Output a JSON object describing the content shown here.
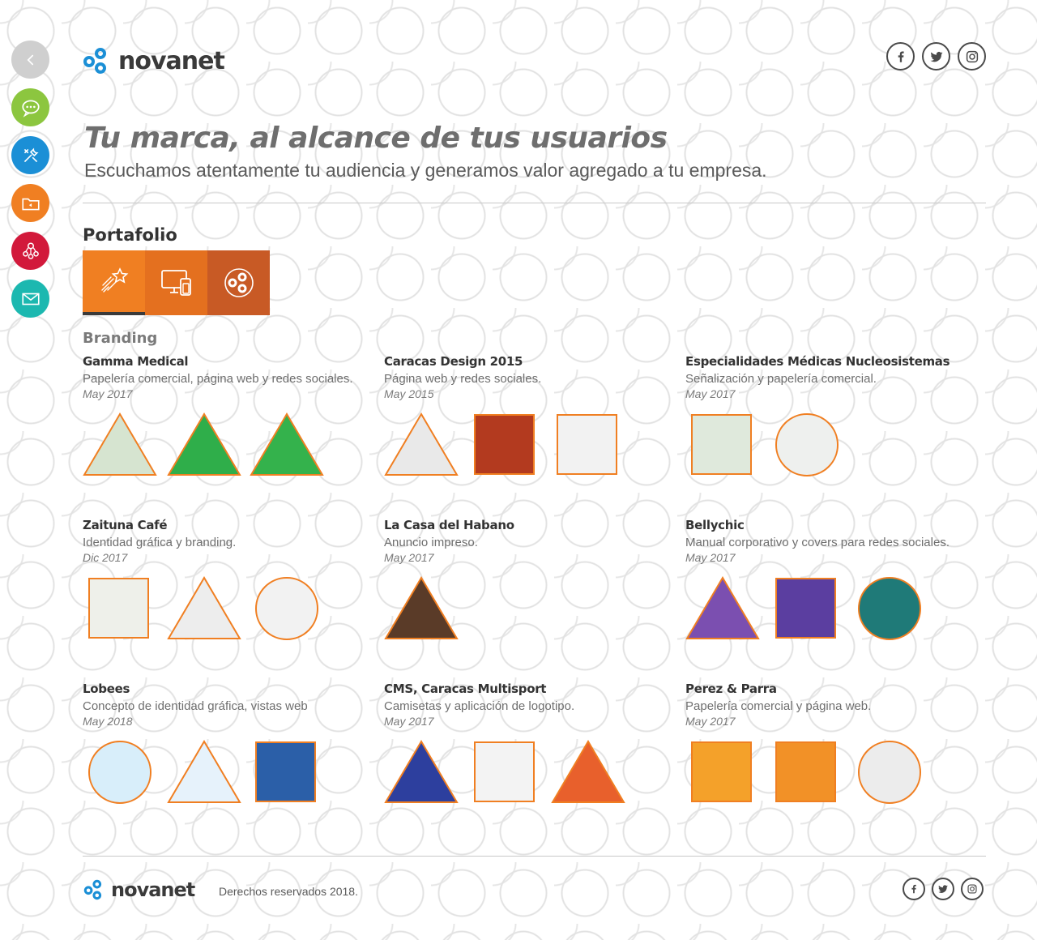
{
  "brand": {
    "name": "novanet"
  },
  "colors": {
    "orange": "#f07f22",
    "tab_mid": "#e4701f",
    "tab_dark": "#c85a25",
    "side_gray": "#cfcfcf",
    "side_green": "#8cc63f",
    "side_blue": "#1b8fd6",
    "side_orange": "#f07f22",
    "side_red": "#d2193b",
    "side_teal": "#1cb8b0",
    "logo_blue": "#1b8fd6"
  },
  "side_nav": [
    {
      "name": "back",
      "icon": "chevron-left-icon"
    },
    {
      "name": "chat",
      "icon": "chat-bubble-icon"
    },
    {
      "name": "tools",
      "icon": "tools-icon"
    },
    {
      "name": "portfolio",
      "icon": "folder-icon"
    },
    {
      "name": "team",
      "icon": "team-icon"
    },
    {
      "name": "contact",
      "icon": "mail-icon"
    }
  ],
  "social": [
    "facebook-icon",
    "twitter-icon",
    "instagram-icon"
  ],
  "hero": {
    "title": "Tu marca, al alcance de tus usuarios",
    "subtitle": "Escuchamos atentamente tu audiencia y generamos valor agregado a tu empresa."
  },
  "portfolio": {
    "title": "Portafolio",
    "tabs": [
      {
        "icon": "shooting-star-icon"
      },
      {
        "icon": "devices-icon"
      },
      {
        "icon": "novanet-circles-icon"
      }
    ],
    "category": "Branding",
    "projects": [
      {
        "title": "Gamma Medical",
        "desc": "Papelería comercial, página web y redes sociales.",
        "date": "May 2017"
      },
      {
        "title": "Caracas Design 2015",
        "desc": "Página web y redes sociales.",
        "date": "May 2015"
      },
      {
        "title": "Especialidades Médicas Nucleosistemas",
        "desc": "Señalización y papelería comercial.",
        "date": "May 2017"
      },
      {
        "title": "Zaituna Café",
        "desc": "Identidad gráfica y branding.",
        "date": "Dic 2017"
      },
      {
        "title": "La Casa del Habano",
        "desc": "Anuncio impreso.",
        "date": "May 2017"
      },
      {
        "title": "Bellychic",
        "desc": "Manual corporativo y covers para redes sociales.",
        "date": "May 2017"
      },
      {
        "title": "Lobees",
        "desc": "Concepto de identidad gráfica, vistas web",
        "date": "May 2018"
      },
      {
        "title": "CMS, Caracas Multisport",
        "desc": "Camisetas y aplicación de logotipo.",
        "date": "May 2017"
      },
      {
        "title": "Perez & Parra",
        "desc": "Papelería comercial y página web.",
        "date": "May 2017"
      }
    ]
  },
  "footer": {
    "copyright": "Derechos reservados 2018."
  }
}
